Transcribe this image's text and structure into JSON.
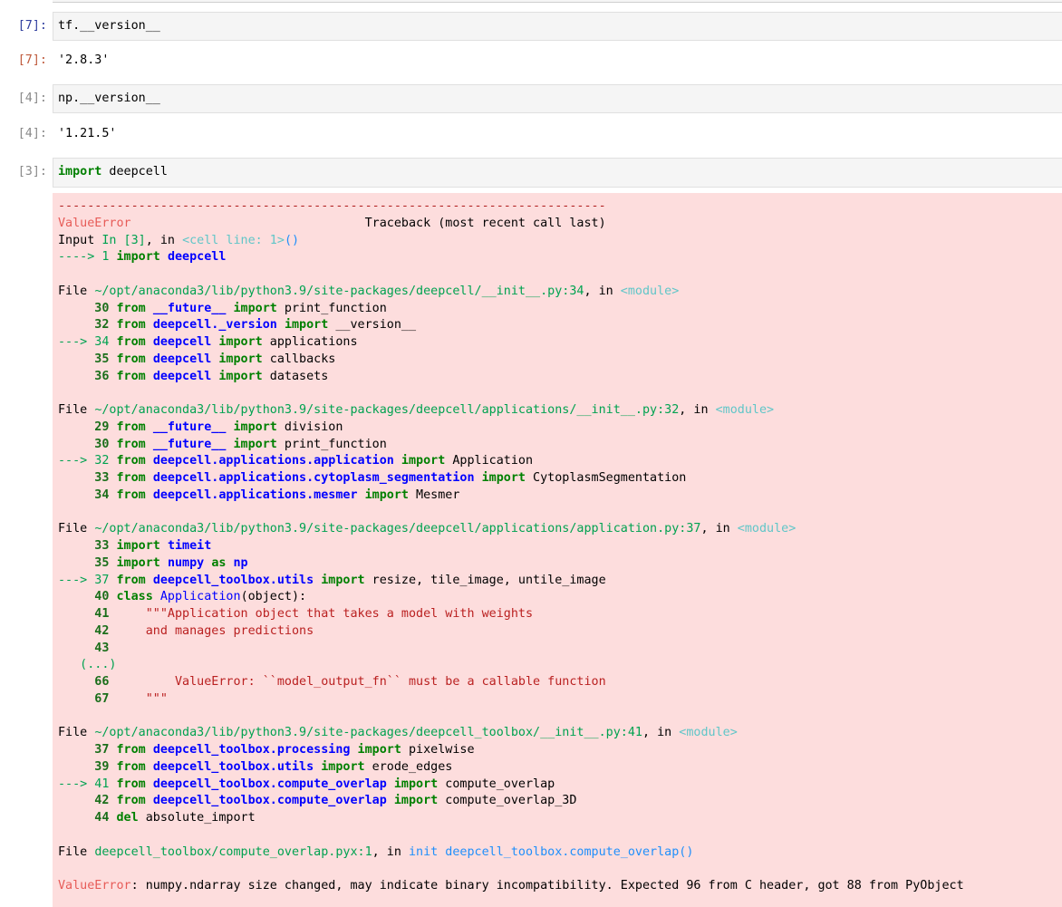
{
  "cells": [
    {
      "in_prompt": "[7]:",
      "code": [
        [
          "plain",
          "tf."
        ],
        [
          "plain",
          "__version__"
        ]
      ],
      "out_prompt": "[7]:",
      "output": "'2.8.3'"
    },
    {
      "in_prompt": "[4]:",
      "code": [
        [
          "plain",
          "np."
        ],
        [
          "plain",
          "__version__"
        ]
      ],
      "out_prompt": "[4]:",
      "output": "'1.21.5'"
    },
    {
      "in_prompt": "[3]:",
      "code_keyword": "import",
      "code_rest": " deepcell"
    }
  ],
  "cell1": {
    "in_prompt": "[7]:",
    "code": "tf.__version__",
    "out_prompt": "[7]:",
    "output": "'2.8.3'"
  },
  "cell2": {
    "in_prompt": "[4]:",
    "code": "np.__version__",
    "out_prompt": "[4]:",
    "output": "'1.21.5'"
  },
  "cell3": {
    "in_prompt": "[3]:",
    "code_keyword": "import",
    "code_rest": " deepcell"
  },
  "traceback": {
    "lines": [
      [
        [
          "dash",
          "---------------------------------------------------------------------------"
        ]
      ],
      [
        [
          "err",
          "ValueError"
        ],
        [
          "plain",
          "                                Traceback (most recent call last)"
        ]
      ],
      [
        [
          "plain",
          "Input "
        ],
        [
          "grn",
          "In [3]"
        ],
        [
          "plain",
          ", in "
        ],
        [
          "cyn",
          "<cell line: 1>"
        ],
        [
          "gr2",
          "()"
        ]
      ],
      [
        [
          "grn",
          "----> 1 "
        ],
        [
          "bkw",
          "import"
        ],
        [
          "plain",
          " "
        ],
        [
          "bmod",
          "deepcell"
        ]
      ],
      [],
      [
        [
          "plain",
          "File "
        ],
        [
          "grn",
          "~/opt/anaconda3/lib/python3.9/site-packages/deepcell/__init__.py:34"
        ],
        [
          "plain",
          ", in "
        ],
        [
          "cyn",
          "<module>"
        ]
      ],
      [
        [
          "lno",
          "     30 "
        ],
        [
          "bkw",
          "from"
        ],
        [
          "plain",
          " "
        ],
        [
          "bmod",
          "__future__"
        ],
        [
          "plain",
          " "
        ],
        [
          "bkw",
          "import"
        ],
        [
          "plain",
          " print_function"
        ]
      ],
      [
        [
          "lno",
          "     32 "
        ],
        [
          "bkw",
          "from"
        ],
        [
          "plain",
          " "
        ],
        [
          "bmod",
          "deepcell._version"
        ],
        [
          "plain",
          " "
        ],
        [
          "bkw",
          "import"
        ],
        [
          "plain",
          " __version__"
        ]
      ],
      [
        [
          "grn",
          "---> 34 "
        ],
        [
          "bkw",
          "from"
        ],
        [
          "plain",
          " "
        ],
        [
          "bmod",
          "deepcell"
        ],
        [
          "plain",
          " "
        ],
        [
          "bkw",
          "import"
        ],
        [
          "plain",
          " applications"
        ]
      ],
      [
        [
          "lno",
          "     35 "
        ],
        [
          "bkw",
          "from"
        ],
        [
          "plain",
          " "
        ],
        [
          "bmod",
          "deepcell"
        ],
        [
          "plain",
          " "
        ],
        [
          "bkw",
          "import"
        ],
        [
          "plain",
          " callbacks"
        ]
      ],
      [
        [
          "lno",
          "     36 "
        ],
        [
          "bkw",
          "from"
        ],
        [
          "plain",
          " "
        ],
        [
          "bmod",
          "deepcell"
        ],
        [
          "plain",
          " "
        ],
        [
          "bkw",
          "import"
        ],
        [
          "plain",
          " datasets"
        ]
      ],
      [],
      [
        [
          "plain",
          "File "
        ],
        [
          "grn",
          "~/opt/anaconda3/lib/python3.9/site-packages/deepcell/applications/__init__.py:32"
        ],
        [
          "plain",
          ", in "
        ],
        [
          "cyn",
          "<module>"
        ]
      ],
      [
        [
          "lno",
          "     29 "
        ],
        [
          "bkw",
          "from"
        ],
        [
          "plain",
          " "
        ],
        [
          "bmod",
          "__future__"
        ],
        [
          "plain",
          " "
        ],
        [
          "bkw",
          "import"
        ],
        [
          "plain",
          " division"
        ]
      ],
      [
        [
          "lno",
          "     30 "
        ],
        [
          "bkw",
          "from"
        ],
        [
          "plain",
          " "
        ],
        [
          "bmod",
          "__future__"
        ],
        [
          "plain",
          " "
        ],
        [
          "bkw",
          "import"
        ],
        [
          "plain",
          " print_function"
        ]
      ],
      [
        [
          "grn",
          "---> 32 "
        ],
        [
          "bkw",
          "from"
        ],
        [
          "plain",
          " "
        ],
        [
          "bmod",
          "deepcell.applications.application"
        ],
        [
          "plain",
          " "
        ],
        [
          "bkw",
          "import"
        ],
        [
          "plain",
          " Application"
        ]
      ],
      [
        [
          "lno",
          "     33 "
        ],
        [
          "bkw",
          "from"
        ],
        [
          "plain",
          " "
        ],
        [
          "bmod",
          "deepcell.applications.cytoplasm_segmentation"
        ],
        [
          "plain",
          " "
        ],
        [
          "bkw",
          "import"
        ],
        [
          "plain",
          " CytoplasmSegmentation"
        ]
      ],
      [
        [
          "lno",
          "     34 "
        ],
        [
          "bkw",
          "from"
        ],
        [
          "plain",
          " "
        ],
        [
          "bmod",
          "deepcell.applications.mesmer"
        ],
        [
          "plain",
          " "
        ],
        [
          "bkw",
          "import"
        ],
        [
          "plain",
          " Mesmer"
        ]
      ],
      [],
      [
        [
          "plain",
          "File "
        ],
        [
          "grn",
          "~/opt/anaconda3/lib/python3.9/site-packages/deepcell/applications/application.py:37"
        ],
        [
          "plain",
          ", in "
        ],
        [
          "cyn",
          "<module>"
        ]
      ],
      [
        [
          "lno",
          "     33 "
        ],
        [
          "bkw",
          "import"
        ],
        [
          "plain",
          " "
        ],
        [
          "bmod",
          "timeit"
        ]
      ],
      [
        [
          "lno",
          "     35 "
        ],
        [
          "bkw",
          "import"
        ],
        [
          "plain",
          " "
        ],
        [
          "bmod",
          "numpy"
        ],
        [
          "plain",
          " "
        ],
        [
          "bkw",
          "as"
        ],
        [
          "plain",
          " "
        ],
        [
          "bmod",
          "np"
        ]
      ],
      [
        [
          "grn",
          "---> 37 "
        ],
        [
          "bkw",
          "from"
        ],
        [
          "plain",
          " "
        ],
        [
          "bmod",
          "deepcell_toolbox.utils"
        ],
        [
          "plain",
          " "
        ],
        [
          "bkw",
          "import"
        ],
        [
          "plain",
          " resize, tile_image, untile_image"
        ]
      ],
      [
        [
          "lno",
          "     40 "
        ],
        [
          "bkw",
          "class"
        ],
        [
          "plain",
          " "
        ],
        [
          "bcls",
          "Application"
        ],
        [
          "plain",
          "(object):"
        ]
      ],
      [
        [
          "lno",
          "     41 "
        ],
        [
          "plain",
          "    "
        ],
        [
          "str",
          "\"\"\"Application object that takes a model with weights"
        ]
      ],
      [
        [
          "lno",
          "     42 "
        ],
        [
          "plain",
          "    "
        ],
        [
          "str",
          "and manages predictions"
        ]
      ],
      [
        [
          "lno",
          "     43 "
        ]
      ],
      [
        [
          "grn",
          "   (...)"
        ]
      ],
      [
        [
          "lno",
          "     66 "
        ],
        [
          "plain",
          "        "
        ],
        [
          "str",
          "ValueError: ``model_output_fn`` must be a callable function"
        ]
      ],
      [
        [
          "lno",
          "     67 "
        ],
        [
          "plain",
          "    "
        ],
        [
          "str",
          "\"\"\""
        ]
      ],
      [],
      [
        [
          "plain",
          "File "
        ],
        [
          "grn",
          "~/opt/anaconda3/lib/python3.9/site-packages/deepcell_toolbox/__init__.py:41"
        ],
        [
          "plain",
          ", in "
        ],
        [
          "cyn",
          "<module>"
        ]
      ],
      [
        [
          "lno",
          "     37 "
        ],
        [
          "bkw",
          "from"
        ],
        [
          "plain",
          " "
        ],
        [
          "bmod",
          "deepcell_toolbox.processing"
        ],
        [
          "plain",
          " "
        ],
        [
          "bkw",
          "import"
        ],
        [
          "plain",
          " pixelwise"
        ]
      ],
      [
        [
          "lno",
          "     39 "
        ],
        [
          "bkw",
          "from"
        ],
        [
          "plain",
          " "
        ],
        [
          "bmod",
          "deepcell_toolbox.utils"
        ],
        [
          "plain",
          " "
        ],
        [
          "bkw",
          "import"
        ],
        [
          "plain",
          " erode_edges"
        ]
      ],
      [
        [
          "grn",
          "---> 41 "
        ],
        [
          "bkw",
          "from"
        ],
        [
          "plain",
          " "
        ],
        [
          "bmod",
          "deepcell_toolbox.compute_overlap"
        ],
        [
          "plain",
          " "
        ],
        [
          "bkw",
          "import"
        ],
        [
          "plain",
          " compute_overlap"
        ]
      ],
      [
        [
          "lno",
          "     42 "
        ],
        [
          "bkw",
          "from"
        ],
        [
          "plain",
          " "
        ],
        [
          "bmod",
          "deepcell_toolbox.compute_overlap"
        ],
        [
          "plain",
          " "
        ],
        [
          "bkw",
          "import"
        ],
        [
          "plain",
          " compute_overlap_3D"
        ]
      ],
      [
        [
          "lno",
          "     44 "
        ],
        [
          "bkw",
          "del"
        ],
        [
          "plain",
          " absolute_import"
        ]
      ],
      [],
      [
        [
          "plain",
          "File "
        ],
        [
          "grn",
          "deepcell_toolbox/compute_overlap.pyx:1"
        ],
        [
          "plain",
          ", in "
        ],
        [
          "gr2",
          "init deepcell_toolbox.compute_overlap"
        ],
        [
          "gr2",
          "()"
        ]
      ],
      [],
      [
        [
          "err",
          "ValueError"
        ],
        [
          "plain",
          ": numpy.ndarray size changed, may indicate binary incompatibility. Expected 96 from C header, got 88 from PyObject"
        ]
      ]
    ]
  },
  "colors": {
    "cell_bg": "#f5f5f5",
    "error_bg": "#fddddd",
    "in_prompt": "#303f9f",
    "out_prompt": "#bf5b3d",
    "keyword": "#008000",
    "module": "#0000ff"
  }
}
